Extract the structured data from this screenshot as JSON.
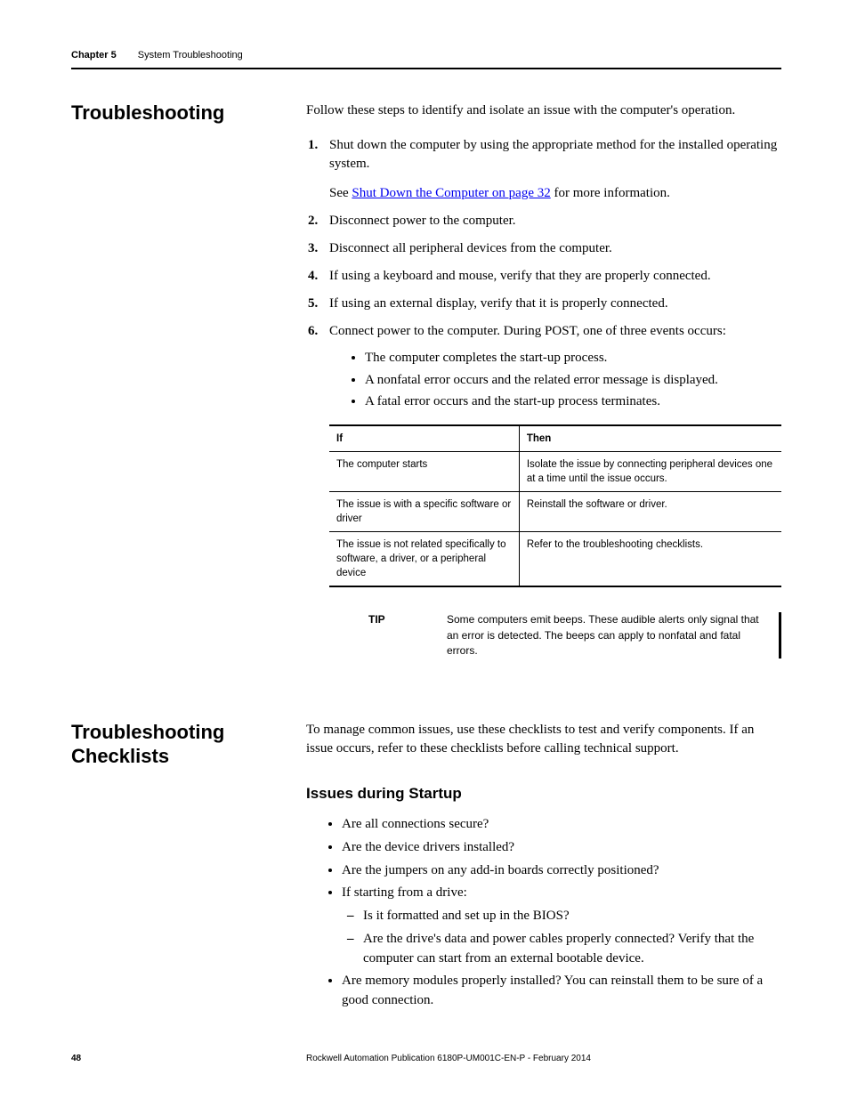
{
  "header": {
    "chapter": "Chapter 5",
    "title": "System Troubleshooting"
  },
  "section1": {
    "title": "Troubleshooting",
    "intro": "Follow these steps to identify and isolate an issue with the computer's operation.",
    "steps": {
      "s1": "Shut down the computer by using the appropriate method for the installed operating system.",
      "s1_sub_pre": "See ",
      "s1_link": "Shut Down the Computer on page 32",
      "s1_sub_post": " for more information.",
      "s2": "Disconnect power to the computer.",
      "s3": "Disconnect all peripheral devices from the computer.",
      "s4": "If using a keyboard and mouse, verify that they are properly connected.",
      "s5": "If using an external display, verify that it is properly connected.",
      "s6": "Connect power to the computer. During POST, one of three events occurs:",
      "s6_b1": "The computer completes the start-up process.",
      "s6_b2": "A nonfatal error occurs and the related error message is displayed.",
      "s6_b3": "A fatal error occurs and the start-up process terminates."
    },
    "table": {
      "h1": "If",
      "h2": "Then",
      "r1c1": "The computer starts",
      "r1c2": "Isolate the issue by connecting peripheral devices one at a time until the issue occurs.",
      "r2c1": "The issue is with a specific software or driver",
      "r2c2": "Reinstall the software or driver.",
      "r3c1": "The issue is not related specifically to software, a driver, or a peripheral device",
      "r3c2": "Refer to the troubleshooting checklists."
    },
    "tip": {
      "label": "TIP",
      "text": "Some computers emit beeps. These audible alerts only signal that an error is detected. The beeps can apply to nonfatal and fatal errors."
    }
  },
  "section2": {
    "title": "Troubleshooting Checklists",
    "intro": "To manage common issues, use these checklists to test and verify components. If an issue occurs, refer to these checklists before calling technical support.",
    "sub_title": "Issues during Startup",
    "items": {
      "i1": "Are all connections secure?",
      "i2": "Are the device drivers installed?",
      "i3": "Are the jumpers on any add-in boards correctly positioned?",
      "i4": "If starting from a drive:",
      "i4_d1": "Is it formatted and set up in the BIOS?",
      "i4_d2": "Are the drive's data and power cables properly connected? Verify that the computer can start from an external bootable device.",
      "i5": "Are memory modules properly installed? You can reinstall them to be sure of a good connection."
    }
  },
  "footer": {
    "page": "48",
    "publication": "Rockwell Automation Publication 6180P-UM001C-EN-P - February 2014"
  }
}
